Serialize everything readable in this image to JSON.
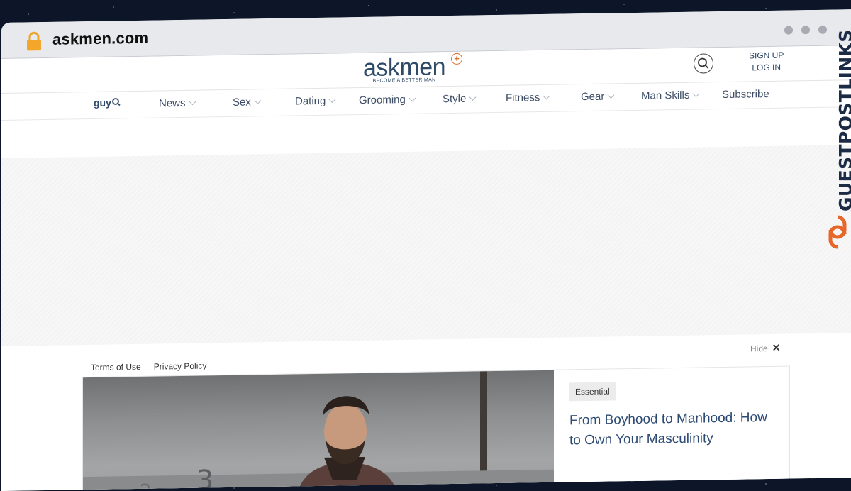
{
  "browser": {
    "url": "askmen.com"
  },
  "header": {
    "logo_text": "askmen",
    "logo_tagline": "BECOME A BETTER MAN",
    "sign_up": "SIGN UP",
    "log_in": "LOG IN"
  },
  "nav": {
    "guy_logo": "guy",
    "items": [
      {
        "label": "News"
      },
      {
        "label": "Sex"
      },
      {
        "label": "Dating"
      },
      {
        "label": "Grooming"
      },
      {
        "label": "Style"
      },
      {
        "label": "Fitness"
      },
      {
        "label": "Gear"
      },
      {
        "label": "Man Skills"
      },
      {
        "label": "Subscribe"
      }
    ]
  },
  "ad": {
    "hide_label": "Hide"
  },
  "footer_links": {
    "terms": "Terms of Use",
    "privacy": "Privacy Policy"
  },
  "feature": {
    "badge": "Essential",
    "headline": "From Boyhood to Manhood: How to Own Your Masculinity"
  },
  "brand": {
    "text": "GUESTPOSTLINKS"
  },
  "colors": {
    "accent_orange": "#e0702a",
    "nav_text": "#3d4d66",
    "headline_blue": "#2c4a73",
    "brand_dark": "#1b2b45"
  }
}
